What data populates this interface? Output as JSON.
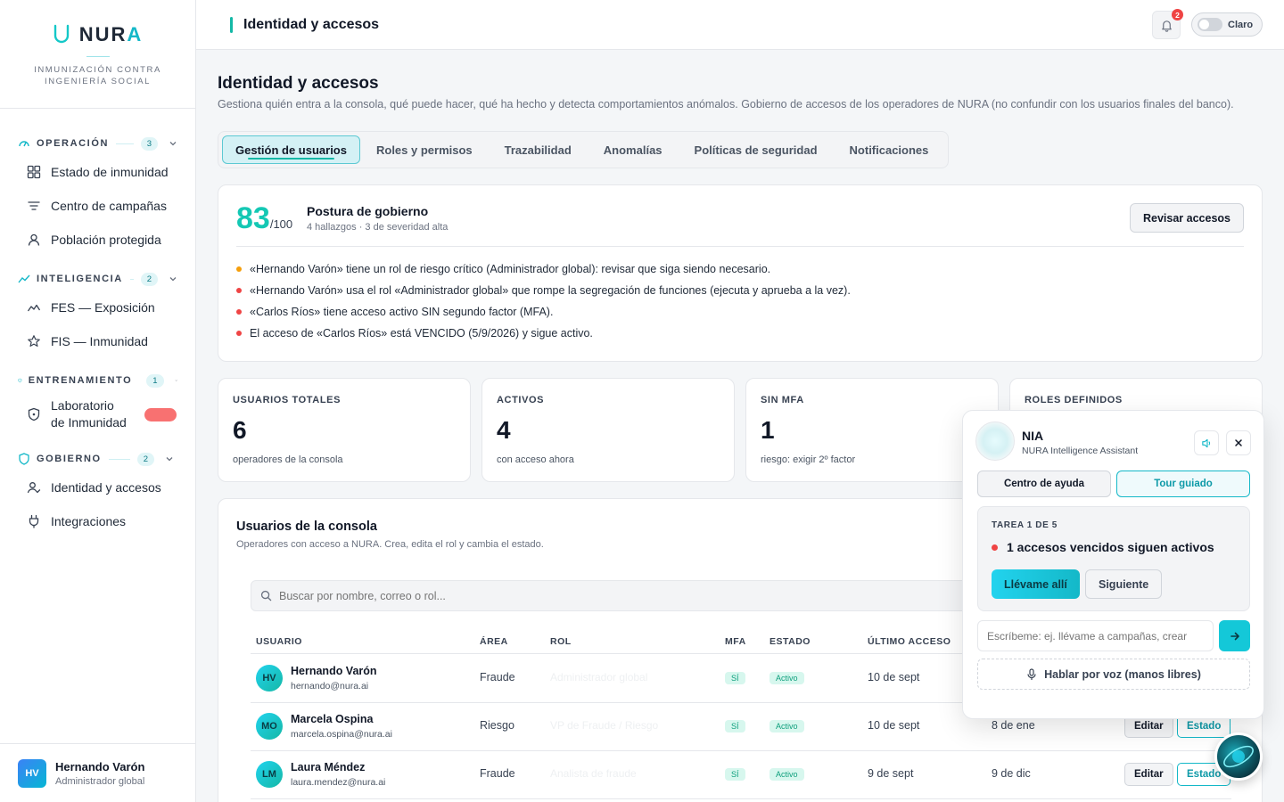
{
  "brand": {
    "name_main": "NUR",
    "name_accent": "A",
    "tagline": "INMUNIZACIÓN CONTRA INGENIERÍA SOCIAL"
  },
  "nav": {
    "sections": [
      {
        "title": "OPERACIÓN",
        "count": "3",
        "items": [
          "Estado de inmunidad",
          "Centro de campañas",
          "Población protegida"
        ]
      },
      {
        "title": "INTELIGENCIA",
        "count": "2",
        "items": [
          "FES — Exposición",
          "FIS — Inmunidad"
        ]
      },
      {
        "title": "ENTRENAMIENTO",
        "count": "1",
        "items_lines": [
          "Laboratorio",
          "de Inmunidad"
        ]
      },
      {
        "title": "GOBIERNO",
        "count": "2",
        "items": [
          "Identidad y accesos",
          "Integraciones"
        ]
      }
    ]
  },
  "current_user": {
    "initials": "HV",
    "name": "Hernando Varón",
    "role": "Administrador global"
  },
  "topbar": {
    "title": "Identidad y accesos",
    "notifications": "2",
    "theme_label": "Claro"
  },
  "page": {
    "title": "Identidad y accesos",
    "subtitle": "Gestiona quién entra a la consola, qué puede hacer, qué ha hecho y detecta comportamientos anómalos. Gobierno de accesos de los operadores de NURA (no confundir con los usuarios finales del banco).",
    "tabs": [
      "Gestión de usuarios",
      "Roles y permisos",
      "Trazabilidad",
      "Anomalías",
      "Políticas de seguridad",
      "Notificaciones"
    ]
  },
  "posture": {
    "score": "83",
    "score_max": "/100",
    "title": "Postura de gobierno",
    "detail": "4 hallazgos · 3 de severidad alta",
    "button": "Revisar accesos",
    "findings": [
      {
        "text": "«Hernando Varón» tiene un rol de riesgo crítico (Administrador global): revisar que siga siendo necesario.",
        "color": "#f59e0b"
      },
      {
        "text": "«Hernando Varón» usa el rol «Administrador global» que rompe la segregación de funciones (ejecuta y aprueba a la vez).",
        "color": "#ef4444"
      },
      {
        "text": "«Carlos Ríos» tiene acceso activo SIN segundo factor (MFA).",
        "color": "#ef4444"
      },
      {
        "text": "El acceso de «Carlos Ríos» está VENCIDO (5/9/2026) y sigue activo.",
        "color": "#ef4444"
      }
    ]
  },
  "stats": [
    {
      "label": "USUARIOS TOTALES",
      "value": "6",
      "note": "operadores de la consola"
    },
    {
      "label": "ACTIVOS",
      "value": "4",
      "note": "con acceso ahora"
    },
    {
      "label": "SIN MFA",
      "value": "1",
      "note": "riesgo: exigir 2º factor"
    },
    {
      "label": "ROLES DEFINIDOS",
      "value": "",
      "note": ""
    }
  ],
  "users_table": {
    "title": "Usuarios de la consola",
    "subtitle": "Operadores con acceso a NURA. Crea, edita el rol y cambia el estado.",
    "search_placeholder": "Buscar por nombre, correo o rol...",
    "headers": [
      "USUARIO",
      "ÁREA",
      "ROL",
      "MFA",
      "ESTADO",
      "ÚLTIMO ACCESO"
    ],
    "edit_label": "Editar",
    "estado_label": "Estado",
    "rows": [
      {
        "initials": "HV",
        "name": "Hernando Varón",
        "email": "hernando@nura.ai",
        "area": "Fraude",
        "role": "Administrador global",
        "mfa": "SÍ",
        "status": "Activo",
        "last": "10 de sept",
        "expires": ""
      },
      {
        "initials": "MO",
        "name": "Marcela Ospina",
        "email": "marcela.ospina@nura.ai",
        "area": "Riesgo",
        "role": "VP de Fraude / Riesgo",
        "mfa": "SÍ",
        "status": "Activo",
        "last": "10 de sept",
        "expires": "8 de ene"
      },
      {
        "initials": "LM",
        "name": "Laura Méndez",
        "email": "laura.mendez@nura.ai",
        "area": "Fraude",
        "role": "Analista de fraude",
        "mfa": "SÍ",
        "status": "Activo",
        "last": "9 de sept",
        "expires": "9 de dic"
      }
    ]
  },
  "assistant": {
    "name": "NIA",
    "subtitle": "NURA Intelligence Assistant",
    "tab_help": "Centro de ayuda",
    "tab_tour": "Tour guiado",
    "task_label": "TAREA 1 DE 5",
    "task_title": "1 accesos vencidos siguen activos",
    "go_label": "Llévame allí",
    "next_label": "Siguiente",
    "input_placeholder": "Escríbeme: ej. llévame a campañas, crear",
    "voice_label": "Hablar por voz (manos libres)"
  }
}
